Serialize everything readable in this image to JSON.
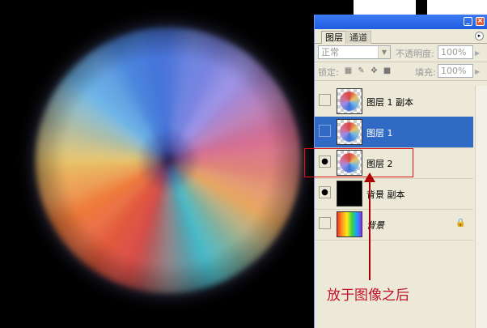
{
  "panel": {
    "tabs": [
      {
        "label": "图层",
        "active": true
      },
      {
        "label": "通道",
        "active": false
      }
    ],
    "title_buttons": {
      "minimize": "_",
      "close": "×"
    },
    "menu_button": "▸",
    "blend_mode": "正常",
    "opacity_label": "不透明度:",
    "opacity_value": "100%",
    "lock_label": "锁定:",
    "fill_label": "填充:",
    "fill_value": "100%"
  },
  "layers": [
    {
      "name": "图层 1 副本",
      "visible": false,
      "selected": false,
      "thumb": "swirl-ball"
    },
    {
      "name": "图层 1",
      "visible": false,
      "selected": true,
      "thumb": "swirl-ball"
    },
    {
      "name": "图层 2",
      "visible": true,
      "selected": false,
      "thumb": "swirl-ball"
    },
    {
      "name": "背景 副本",
      "visible": true,
      "selected": false,
      "thumb": "black"
    },
    {
      "name": "背景",
      "visible": false,
      "selected": false,
      "thumb": "rainbow",
      "locked": true
    }
  ],
  "annotation": {
    "note": "放于图像之后",
    "color": "#c2122a"
  },
  "icons": {
    "eye": "eye-icon",
    "lock": "lock-icon"
  }
}
